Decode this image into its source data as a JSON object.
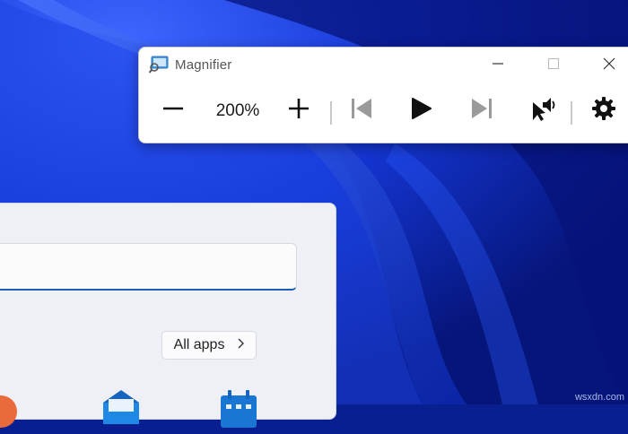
{
  "magnifier": {
    "title": "Magnifier",
    "zoom_level": "200%",
    "icons": {
      "app": "magnifier-app-icon",
      "minimize": "minimize-icon",
      "maximize": "maximize-icon",
      "close": "close-icon",
      "zoom_out": "minus-icon",
      "zoom_in": "plus-icon",
      "previous": "skip-previous-icon",
      "play": "play-icon",
      "next": "skip-next-icon",
      "read_from_here": "read-from-here-icon",
      "settings": "gear-icon"
    }
  },
  "start_menu": {
    "search_value": "",
    "all_apps_label": "All apps",
    "all_apps_icon": "chevron-right-icon",
    "accent_color": "#1a5fb4"
  },
  "watermark": "wsxdn.com",
  "colors": {
    "wallpaper": "#0a1f8f",
    "window_bg": "#ffffff",
    "panel_bg": "#eef0f5"
  }
}
